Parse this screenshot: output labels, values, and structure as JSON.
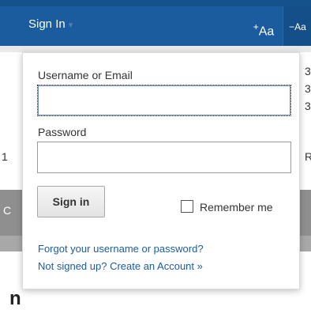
{
  "topbar": {
    "signin_label": "Sign In",
    "caret": "▾",
    "font_increase_label": "Aa",
    "font_increase_sign": "+",
    "font_decrease_label": "Aa",
    "font_decrease_sign": "−"
  },
  "background": {
    "right_text_1": "3",
    "right_text_2": "3",
    "right_text_3": "3",
    "left_text": "1",
    "right_text_4": "R",
    "band_letter": "C",
    "bottom_glyph": "n"
  },
  "login": {
    "username_label": "Username or Email",
    "username_value": "",
    "password_label": "Password",
    "password_value": "",
    "signin_button": "Sign in",
    "remember_label": "Remember me",
    "remember_checked": false,
    "forgot_link": "Forgot your username or password?",
    "create_link": "Not signed up? Create an Account »"
  },
  "colors": {
    "nav_blue": "#1a5c9e",
    "link_blue": "#1a5c9e"
  }
}
